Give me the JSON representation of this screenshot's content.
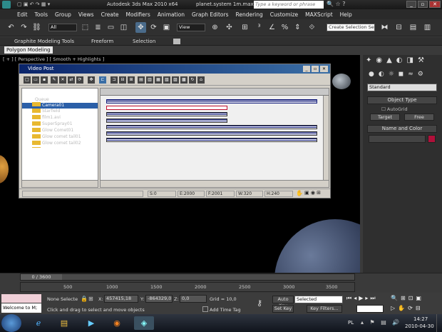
{
  "window": {
    "title": "Autodesk 3ds Max 2010 x64",
    "file": "planet.system 1m.max",
    "search_placeholder": "Type a keyword or phrase"
  },
  "menu": [
    "Edit",
    "Tools",
    "Group",
    "Views",
    "Create",
    "Modifiers",
    "Animation",
    "Graph Editors",
    "Rendering",
    "Customize",
    "MAXScript",
    "Help"
  ],
  "toolbar": {
    "filter": "All",
    "view": "View",
    "selection_set": "Create Selection Se"
  },
  "ribbon": {
    "tabs": [
      "Graphite Modeling Tools",
      "Freeform",
      "Selection"
    ],
    "sub": "Polygon Modeling"
  },
  "viewport": {
    "label": "[ + ] [ Perspective ] [ Smooth + Highlights ]"
  },
  "cmdpanel": {
    "dropdown": "Standard",
    "object_type": "Object Type",
    "autogrid": "AutoGrid",
    "buttons": [
      "Target",
      "Free"
    ],
    "name_color": "Name and Color",
    "swatch": "#b0103a"
  },
  "videopost": {
    "title": "Video Post",
    "tree": [
      "Queue",
      "Camera01",
      "Starfield",
      "film1.avi",
      "SuperSpray01",
      "Glow Comet01",
      "Glow comet tail01",
      "Glow comet tail02"
    ],
    "status": {
      "s": "S:0",
      "e": "E:2000",
      "f": "F:2001",
      "w": "W:320",
      "h": "H:240"
    }
  },
  "timeline": {
    "counter": "0 / 3600",
    "ticks": [
      "500",
      "1000",
      "1500",
      "2000",
      "2500",
      "3000",
      "3500"
    ]
  },
  "status": {
    "maxscript": "Welcome to M;",
    "selection": "None Selecte",
    "x": "457415,18",
    "y": "-864329,0",
    "z": "0,0",
    "grid": "Grid = 10,0",
    "autokey": "Auto Key",
    "setkey": "Set Key",
    "selected": "Selected",
    "keyfilters": "Key Filters...",
    "add_time_tag": "Add Time Tag",
    "prompt": "Click and drag to select and move objects"
  },
  "taskbar": {
    "lang": "PL",
    "time": "14:27",
    "date": "2010-04-30"
  }
}
